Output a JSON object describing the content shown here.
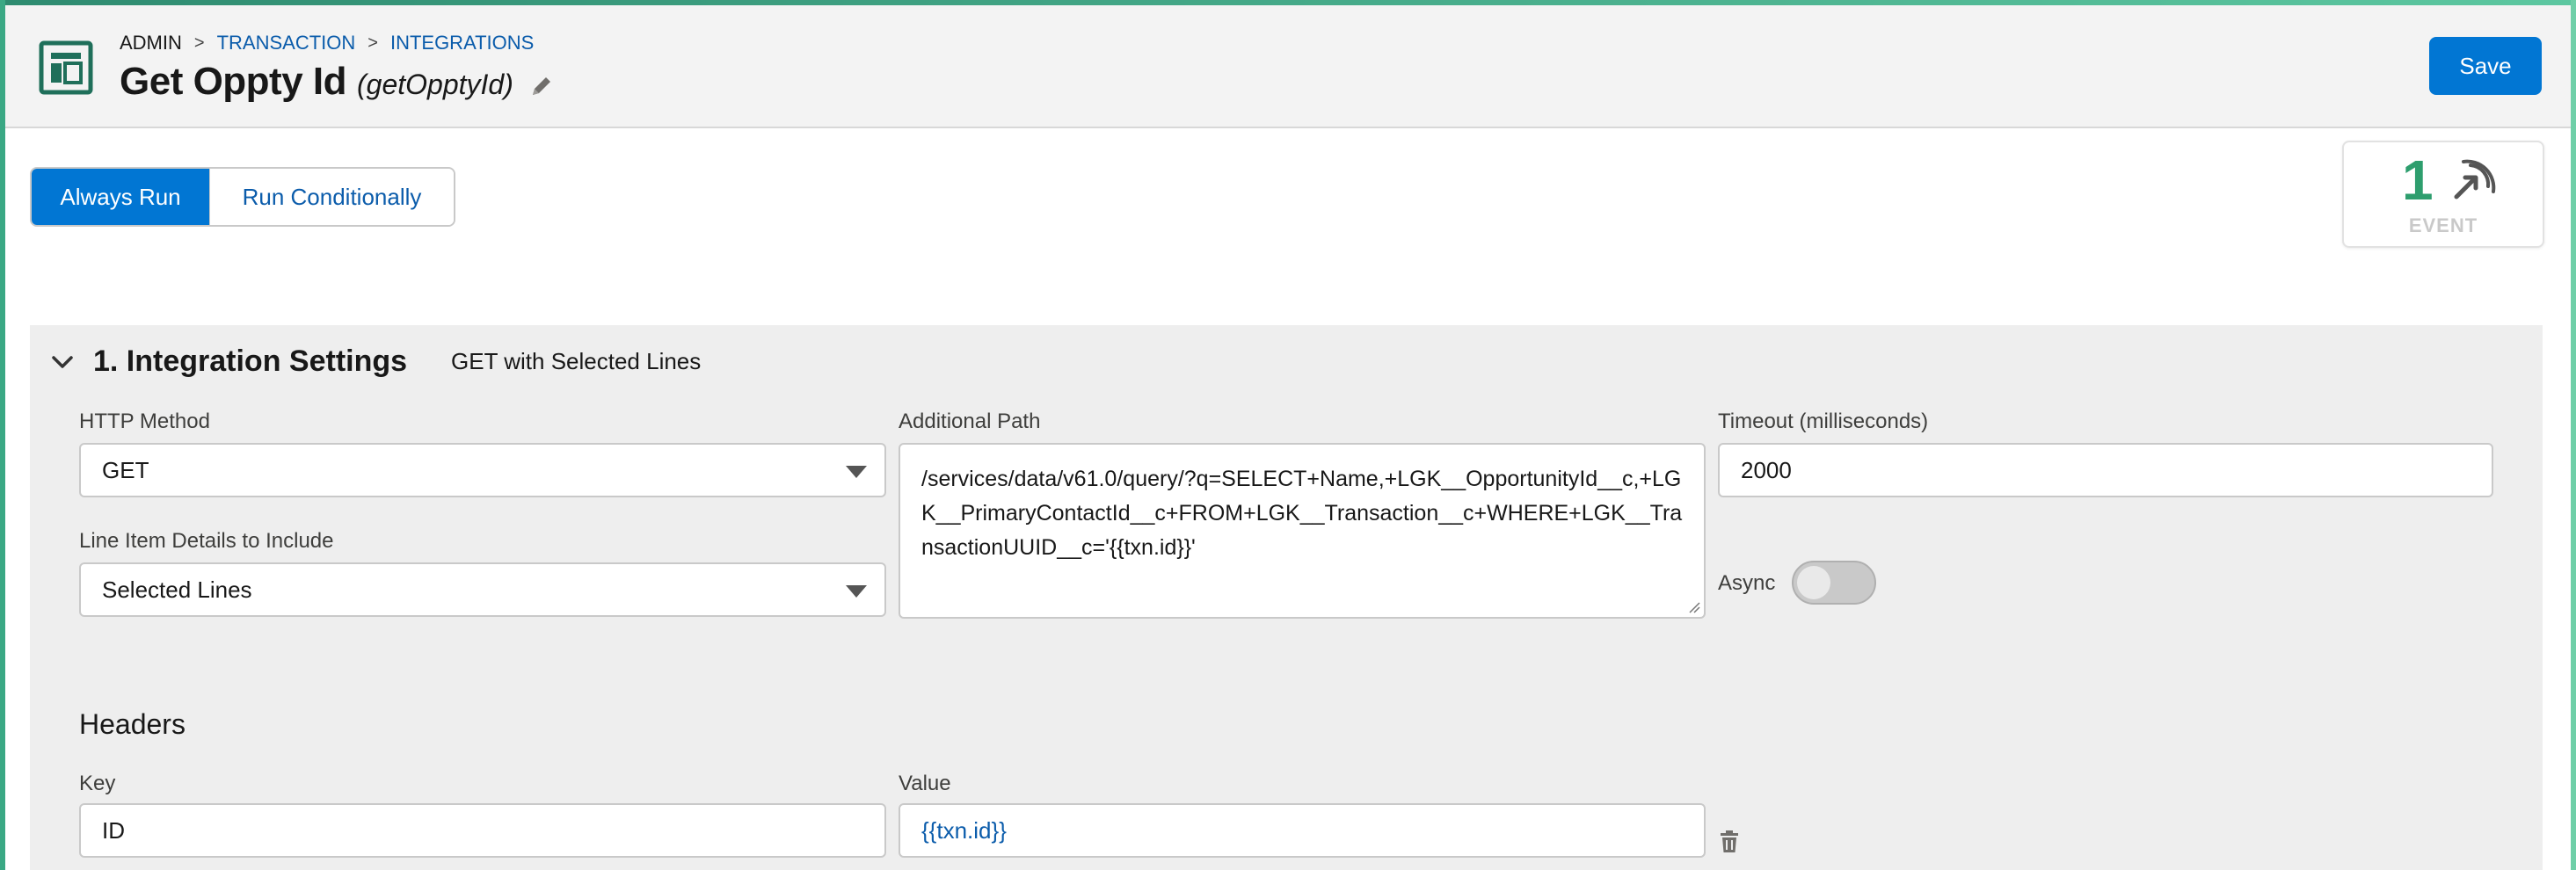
{
  "breadcrumb": [
    "ADMIN",
    "TRANSACTION",
    "INTEGRATIONS"
  ],
  "breadcrumb_sep": ">",
  "page": {
    "title": "Get Oppty Id",
    "subtitle": "(getOpptyId)"
  },
  "toolbar": {
    "save_label": "Save"
  },
  "run_mode": {
    "options": [
      "Always Run",
      "Run Conditionally"
    ],
    "selected": "Always Run"
  },
  "event_card": {
    "count": "1",
    "label": "EVENT"
  },
  "section": {
    "title": "1. Integration Settings",
    "description": "GET with Selected Lines",
    "http_method": {
      "label": "HTTP Method",
      "value": "GET"
    },
    "line_items": {
      "label": "Line Item Details to Include",
      "value": "Selected Lines"
    },
    "additional_path": {
      "label": "Additional Path",
      "value": "/services/data/v61.0/query/?q=SELECT+Name,+LGK__OpportunityId__c,+LGK__PrimaryContactId__c+FROM+LGK__Transaction__c+WHERE+LGK__TransactionUUID__c='{{txn.id}}'"
    },
    "timeout": {
      "label": "Timeout (milliseconds)",
      "value": "2000"
    },
    "async": {
      "label": "Async",
      "enabled": false
    },
    "headers": {
      "title": "Headers",
      "key_label": "Key",
      "value_label": "Value",
      "rows": [
        {
          "key": "ID",
          "value": "{{txn.id}}"
        }
      ]
    }
  },
  "colors": {
    "brand": "#0176d3",
    "accent_green": "#2e9e6e",
    "link": "#0b5cab"
  },
  "icons": [
    "app-layout-icon",
    "edit-pencil-icon",
    "event-signal-icon",
    "chevron-down-icon",
    "trash-icon"
  ]
}
